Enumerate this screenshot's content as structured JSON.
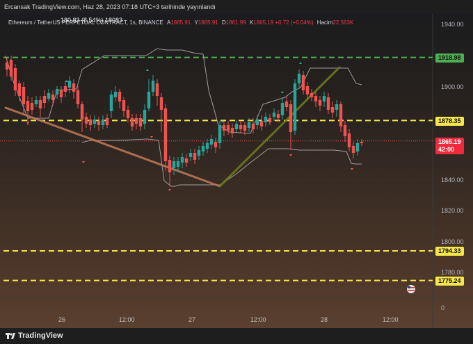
{
  "header": {
    "published_by": "Ercansak TradingView.com, Haz 28, 2023 07:18 UTC+3 tarihinde yayınlandı",
    "overlap_text": "180.83 (8.54%) 18083"
  },
  "symbol_line": {
    "symbol": "Ethereum / TetherUS PERPETUAL CONTRACT, 1s, BINANCE",
    "open_label": "A",
    "open": "1865.91",
    "high_label": "Y",
    "high": "1865.91",
    "low_label": "D",
    "low": "1861.99",
    "close_label": "K",
    "close": "1865.19",
    "change": "+0.72 (+0.04%)",
    "volume_label": "Hacim",
    "volume": "22.563K"
  },
  "price_axis": {
    "ticks": [
      "1940.00",
      "1900.00",
      "1840.00",
      "1820.00",
      "1800.00",
      "1780.00",
      "0"
    ],
    "current_price": "1865.19",
    "countdown": "42:00"
  },
  "levels": [
    {
      "price": "1918.98",
      "color": "#4caf50"
    },
    {
      "price": "1878.35",
      "color": "#f5e74b"
    },
    {
      "price": "1794.33",
      "color": "#f5e74b"
    },
    {
      "price": "1775.24",
      "color": "#f5e74b"
    }
  ],
  "time_axis": [
    "26",
    "12:00",
    "27",
    "12:00",
    "28",
    "12:00"
  ],
  "colors": {
    "up": "#26a69a",
    "down": "#ef5350",
    "trend_down": "#c07a5a",
    "trend_up": "#6b7a20",
    "green_level": "#4caf50",
    "yellow_level": "#f5e74b"
  },
  "footer": {
    "brand": "TradingView",
    "icon": "tradingview-logo-icon"
  }
}
